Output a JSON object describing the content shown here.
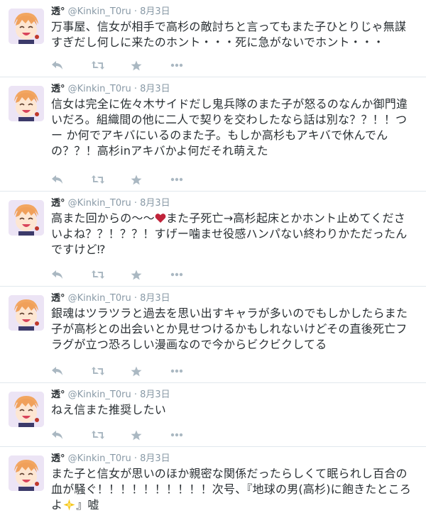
{
  "user": {
    "name": "透°",
    "handle": "@Kinkin_T0ru",
    "avatar_icon": "anime-boy-avatar-icon"
  },
  "actions": {
    "reply_icon": "reply-icon",
    "retweet_icon": "retweet-icon",
    "favorite_icon": "star-icon",
    "more_icon": "more-dots-icon"
  },
  "colors": {
    "text": "#292f33",
    "meta": "#8899a6",
    "icon": "#aab8c2",
    "divider": "#e1e8ed",
    "heart": "#c0233a"
  },
  "tweets": [
    {
      "date": "8月3日",
      "lines": [
        "万事屋、信女が相手で高杉の敵討ちと言ってもまた子ひとりじゃ無謀",
        "すぎだし何しに来たのホント・・・死に急がないでホント・・・"
      ]
    },
    {
      "date": "8月3日",
      "lines": [
        "信女は完全に佐々木サイドだし鬼兵隊のまた子が怒るのなんか御門違",
        "いだろ。組織間の他に二人で契りを交わしたなら話は別な？？！！つ",
        "ー か何でアキバにいるのまた子。もしか高杉もアキバで休んでん",
        "の？？！高杉inアキバかよ何だそれ萌えた"
      ]
    },
    {
      "date": "8月3日",
      "line1_pre": "高また回からの～～",
      "line1_post": "また子死亡→高杉起床とかホント止めてくださ",
      "heart_icon": "heart-icon",
      "lines": [
        "いよね？？！？？！すげー噛ませ役感ハンパない終わりかただったん",
        "ですけど⁉"
      ]
    },
    {
      "date": "8月3日",
      "lines": [
        "銀魂はツラツラと過去を思い出すキャラが多いのでもしかしたらまた",
        "子が高杉との出会いとか見せつけるかもしれないけどその直後死亡フ",
        "ラグが立つ恐ろしい漫画なので今からビクビクしてる"
      ]
    },
    {
      "date": "8月3日",
      "lines": [
        "ねえ信また推奨したい"
      ]
    },
    {
      "date": "8月3日",
      "lines": [
        "また子と信女が思いのほか親密な関係だったらしくて眠られし百合の",
        "血が騒ぐ！！！！！！！！！！次号、『地球の男(高杉)に飽きたところ"
      ],
      "last_pre": "よ",
      "sparkle_icon": "sparkle-emoji-icon",
      "last_post": "』嘘"
    }
  ]
}
